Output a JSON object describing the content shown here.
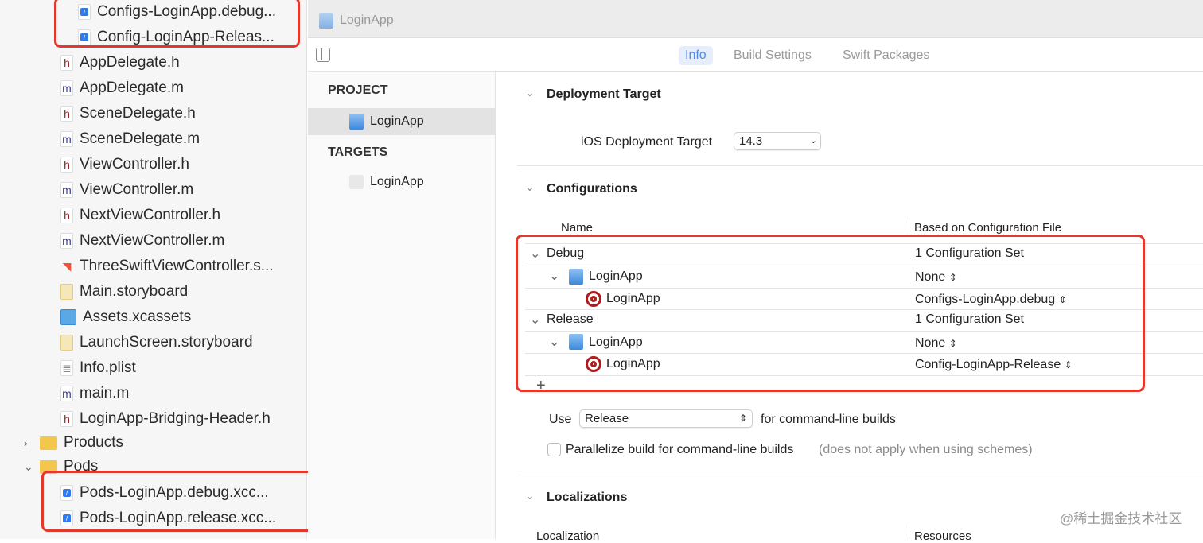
{
  "navigator": {
    "files": [
      {
        "name": "Configs-LoginApp.debug...",
        "type": "cfg",
        "indent": 1
      },
      {
        "name": "Config-LoginApp-Releas...",
        "type": "cfg",
        "indent": 1
      },
      {
        "name": "AppDelegate.h",
        "type": "h"
      },
      {
        "name": "AppDelegate.m",
        "type": "m"
      },
      {
        "name": "SceneDelegate.h",
        "type": "h"
      },
      {
        "name": "SceneDelegate.m",
        "type": "m"
      },
      {
        "name": "ViewController.h",
        "type": "h"
      },
      {
        "name": "ViewController.m",
        "type": "m"
      },
      {
        "name": "NextViewController.h",
        "type": "h"
      },
      {
        "name": "NextViewController.m",
        "type": "m"
      },
      {
        "name": "ThreeSwiftViewController.s...",
        "type": "swift"
      },
      {
        "name": "Main.storyboard",
        "type": "sb"
      },
      {
        "name": "Assets.xcassets",
        "type": "assets"
      },
      {
        "name": "LaunchScreen.storyboard",
        "type": "sb"
      },
      {
        "name": "Info.plist",
        "type": "plist"
      },
      {
        "name": "main.m",
        "type": "m"
      },
      {
        "name": "LoginApp-Bridging-Header.h",
        "type": "h"
      }
    ],
    "products": "Products",
    "pods": "Pods",
    "pod_files": [
      "Pods-LoginApp.debug.xcc...",
      "Pods-LoginApp.release.xcc..."
    ]
  },
  "tabbar": {
    "title": "LoginApp"
  },
  "toolbar": {
    "tabs": [
      "Info",
      "Build Settings",
      "Swift Packages"
    ]
  },
  "project_list": {
    "project_header": "PROJECT",
    "project": "LoginApp",
    "targets_header": "TARGETS",
    "target": "LoginApp"
  },
  "deployment": {
    "title": "Deployment Target",
    "label": "iOS Deployment Target",
    "value": "14.3"
  },
  "configurations": {
    "title": "Configurations",
    "col_name": "Name",
    "col_file": "Based on Configuration File",
    "rows": [
      {
        "name": "Debug",
        "value": "1 Configuration Set"
      },
      {
        "name": "LoginApp",
        "value": "None"
      },
      {
        "name": "LoginApp",
        "value": "Configs-LoginApp.debug"
      },
      {
        "name": "Release",
        "value": "1 Configuration Set"
      },
      {
        "name": "LoginApp",
        "value": "None"
      },
      {
        "name": "LoginApp",
        "value": "Config-LoginApp-Release"
      }
    ],
    "use_label": "Use",
    "use_value": "Release",
    "use_suffix": "for command-line builds",
    "parallelize": "Parallelize build for command-line builds",
    "parallelize_note": "(does not apply when using schemes)"
  },
  "localizations": {
    "title": "Localizations",
    "col_loc": "Localization",
    "col_res": "Resources"
  },
  "watermark": "@稀土掘金技术社区"
}
